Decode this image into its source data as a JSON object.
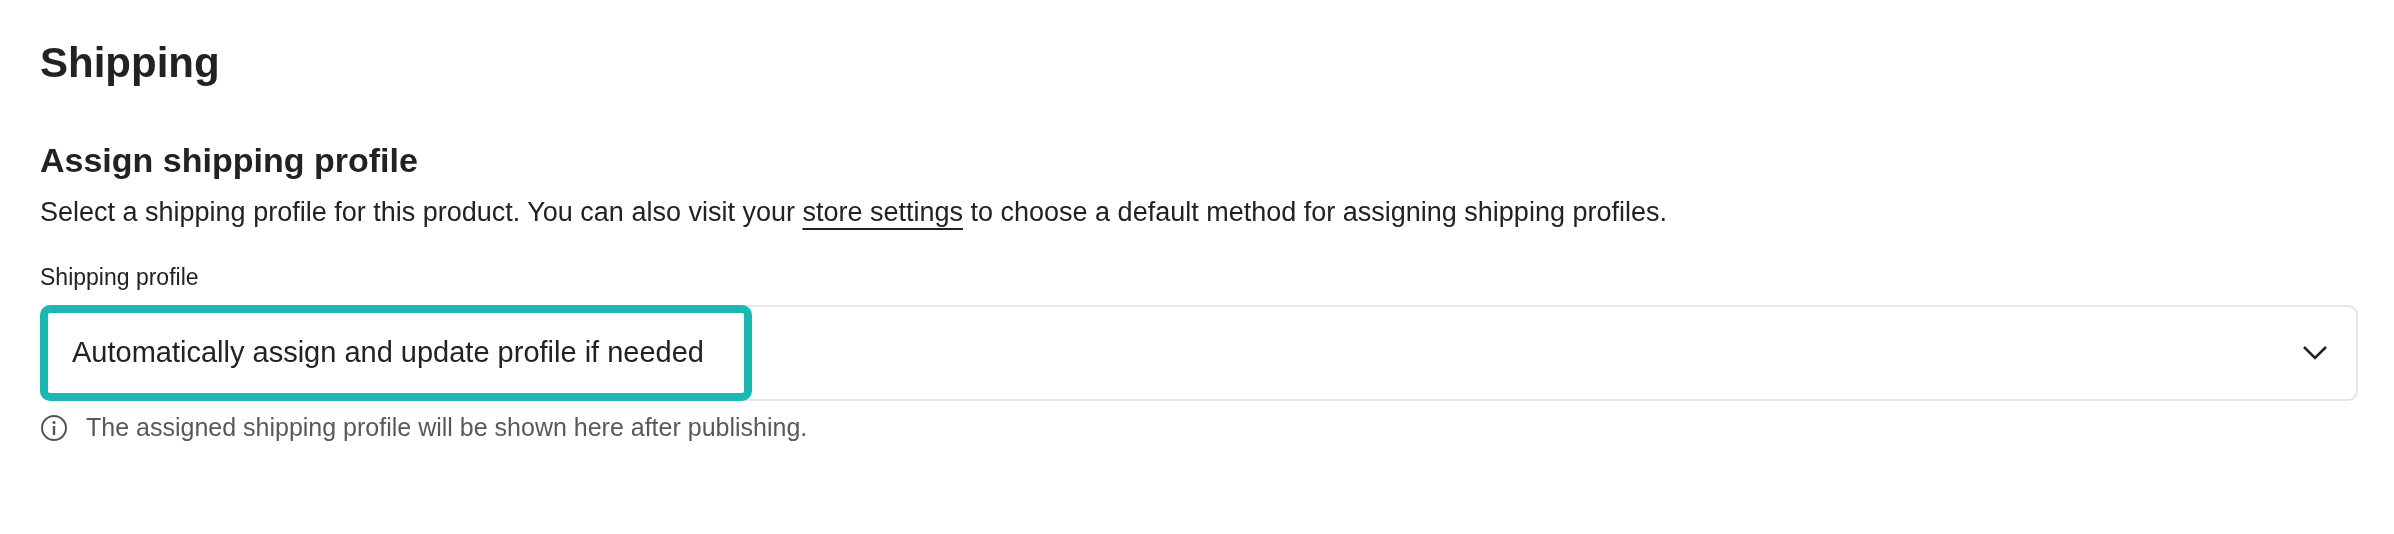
{
  "title": "Shipping",
  "section": {
    "heading": "Assign shipping profile",
    "description": {
      "before": "Select a shipping profile for this product. You can also visit your ",
      "link": "store settings",
      "after": " to choose a default method for assigning shipping profiles."
    },
    "field": {
      "label": "Shipping profile",
      "value": "Automatically assign and update profile if needed",
      "highlighted": true,
      "help": "The assigned shipping profile will be shown here after publishing."
    }
  }
}
